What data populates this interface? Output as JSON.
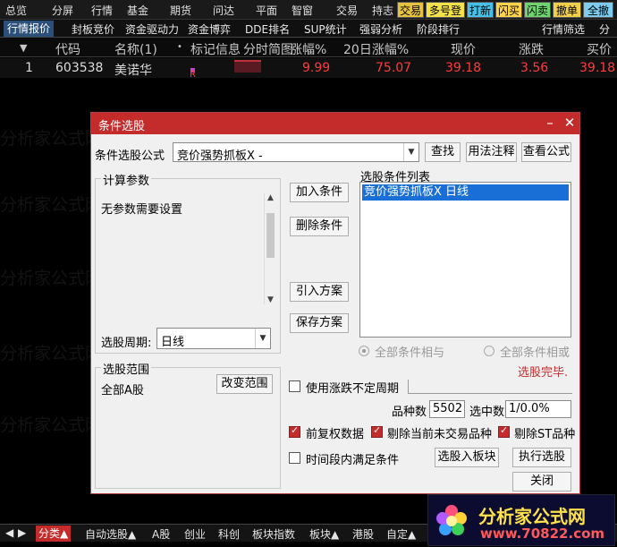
{
  "menu": {
    "items": [
      "总览",
      "分屏",
      "行情",
      "基金",
      "期货",
      "问达",
      "平面",
      "智窗",
      "交易",
      "持志"
    ],
    "color_buttons": [
      {
        "label": "交易",
        "color": "#e6c33b"
      },
      {
        "label": "多号登",
        "color": "#f4e24a"
      },
      {
        "label": "打新",
        "color": "#46c0e8"
      },
      {
        "label": "闪买",
        "color": "#ffd44a"
      },
      {
        "label": "闪卖",
        "color": "#6fd46f"
      },
      {
        "label": "撤单",
        "color": "#f2cf48"
      },
      {
        "label": "全撤",
        "color": "#7fcdee"
      }
    ]
  },
  "tabs": [
    "行情报价",
    "封板竞价",
    "资金驱动力",
    "资金博弈",
    "DDE排名",
    "SUP统计",
    "强弱分析",
    "阶段排行",
    "行情筛选",
    "分"
  ],
  "table": {
    "headers": [
      "代码",
      "名称(1)",
      "标记信息",
      "分时简图",
      "涨幅%",
      "20日涨幅%",
      "现价",
      "涨跌",
      "买价"
    ],
    "row": {
      "index": "1",
      "code": "603538",
      "name": "美诺华",
      "mark": "R",
      "pct": "9.99",
      "pct20": "75.07",
      "price": "39.18",
      "change": "3.56",
      "bid": "39.18"
    }
  },
  "dialog": {
    "title": "条件选股",
    "formula_label": "条件选股公式",
    "formula_value": "竞价强势抓板X  -",
    "find_button": "查找",
    "usage_button": "用法注释",
    "view_button": "查看公式",
    "params_group": "计算参数",
    "params_text": "无参数需要设置",
    "period_label": "选股周期:",
    "period_value": "日线",
    "add_condition": "加入条件",
    "delete_condition": "删除条件",
    "import_scheme": "引入方案",
    "save_scheme": "保存方案",
    "condition_list_label": "选股条件列表",
    "condition_item": "竞价强势抓板X  日线",
    "radio_and": "全部条件相与",
    "radio_or": "全部条件相或",
    "status": "选股完毕.",
    "range_group": "选股范围",
    "range_value": "全部A股",
    "change_range": "改变范围",
    "use_period": "使用涨跌不定周期",
    "count_label": "品种数",
    "count_value": "5502",
    "selected_label": "选中数",
    "selected_value": "1/0.0%",
    "rehab": "前复权数据",
    "exclude_untraded": "剔除当前未交易品种",
    "exclude_st": "剔除ST品种",
    "period_meet": "时间段内满足条件",
    "to_block": "选股入板块",
    "execute": "执行选股",
    "close": "关闭"
  },
  "bottom_tabs": [
    "分类▲",
    "自动选股▲",
    "A股",
    "创业",
    "科创",
    "板块指数",
    "板块▲",
    "港股",
    "自定▲"
  ],
  "logo": {
    "title": "分析家公式网",
    "url": "www.70822.com"
  },
  "colors": {
    "accent": "#c42b2b",
    "up": "#ff3b3b",
    "selection": "#1a6fd6"
  }
}
